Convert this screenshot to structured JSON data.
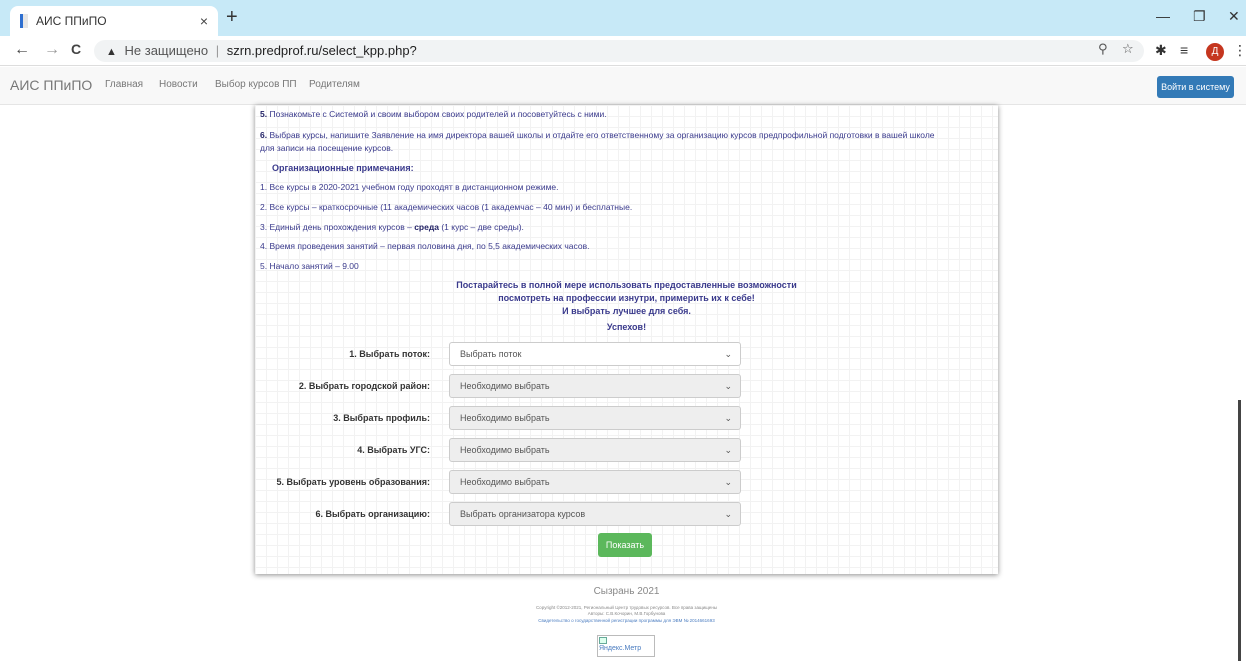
{
  "browser": {
    "tab_title": "АИС ППиПО",
    "tab_close": "×",
    "new_tab": "+",
    "win_min": "—",
    "win_max": "❐",
    "win_close": "✕",
    "back": "←",
    "forward": "→",
    "reload": "C",
    "security_icon": "▲",
    "security_text": "Не защищено",
    "separator": "|",
    "url": "szrn.predprof.ru/select_kpp.php?",
    "profile_letter": "Д"
  },
  "site_nav": {
    "brand": "АИС ППиПО",
    "links": [
      "Главная",
      "Новости",
      "Выбор курсов ПП",
      "Родителям"
    ],
    "login": "Войти в систему"
  },
  "instructions": {
    "step5_num": "5.",
    "step5_text": " Познакомьте с Системой и своим выбором своих родителей и посоветуйтесь с ними.",
    "step6_num": "6.",
    "step6_line1": " Выбрав курсы, напишите Заявление на имя директора вашей школы и отдайте его ответственному за организацию курсов предпрофильной подготовки в вашей школе",
    "step6_line2": "для записи на посещение курсов."
  },
  "notes": {
    "heading": "Организационные примечания:",
    "n1": "1. Все курсы в 2020-2021 учебном году проходят в дистанционном режиме.",
    "n2": "2. Все курсы – краткосрочные (11 академических часов (1 академчас – 40 мин) и бесплатные.",
    "n3_pre": "3. Единый день прохождения курсов – ",
    "n3_bold": "среда",
    "n3_post": " (1 курс – две среды).",
    "n4": "4. Время проведения занятий – первая половина дня, по 5,5 академических часов.",
    "n5": "5. Начало занятий – 9.00"
  },
  "motivation": {
    "line1": "Постарайтесь в полной мере использовать предоставленные возможности",
    "line2": "посмотреть на профессии изнутри, примерить их к себе!",
    "line3": "И выбрать лучшее для себя.",
    "line4": "Успехов!"
  },
  "form": {
    "fields": [
      {
        "label": "1. Выбрать поток:",
        "value": "Выбрать поток"
      },
      {
        "label": "2. Выбрать городской район:",
        "value": "Необходимо выбрать"
      },
      {
        "label": "3. Выбрать профиль:",
        "value": "Необходимо выбрать"
      },
      {
        "label": "4. Выбрать УГС:",
        "value": "Необходимо выбрать"
      },
      {
        "label": "5. Выбрать уровень образования:",
        "value": "Необходимо выбрать"
      },
      {
        "label": "6. Выбрать организацию:",
        "value": "Выбрать организатора курсов"
      }
    ],
    "submit": "Показать"
  },
  "footer": {
    "city": "Сызрань 2021",
    "copyright": "Copyright ©2012-2021, Региональный Центр трудовых ресурсов. Все права защищены",
    "authors": "Авторы: С.В.Кочорин, М.В.Горбунова",
    "certificate": "Свидетельство о государственной регистрации программы для ЭВМ № 2014661693",
    "metrika": "Яндекс.Метр"
  }
}
